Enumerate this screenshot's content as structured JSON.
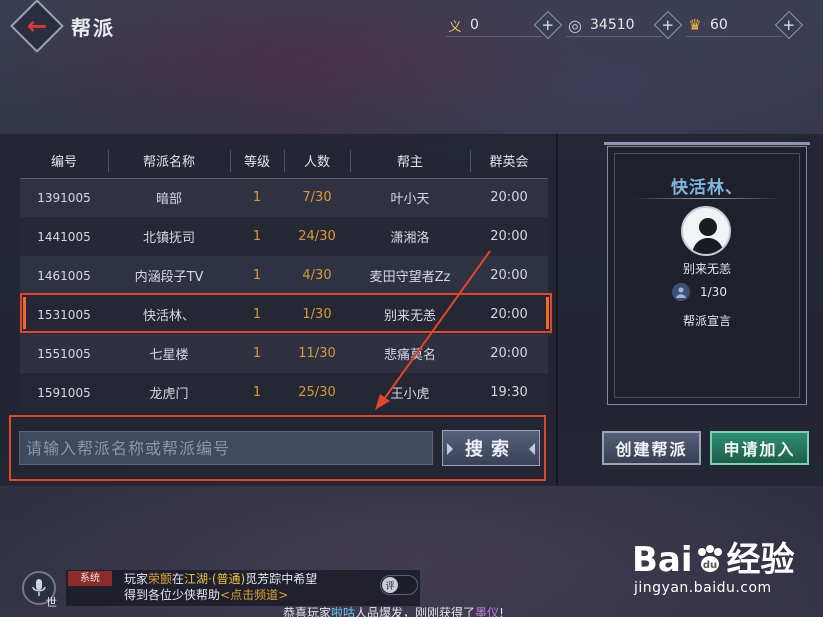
{
  "header": {
    "title": "帮派",
    "resources": [
      {
        "icon": "yi-token-icon",
        "symbol": "义",
        "value": "0"
      },
      {
        "icon": "silver-coin-icon",
        "symbol": "◎",
        "value": "34510"
      },
      {
        "icon": "gold-ingot-icon",
        "symbol": "♛",
        "value": "60"
      }
    ]
  },
  "table": {
    "headers": [
      "编号",
      "帮派名称",
      "等级",
      "人数",
      "帮主",
      "群英会"
    ],
    "rows": [
      {
        "id": "1391005",
        "name": "暗部",
        "level": "1",
        "members": "7/30",
        "leader": "叶小天",
        "time": "20:00"
      },
      {
        "id": "1441005",
        "name": "北镇抚司",
        "level": "1",
        "members": "24/30",
        "leader": "潇湘洛",
        "time": "20:00"
      },
      {
        "id": "1461005",
        "name": "内涵段子TV",
        "level": "1",
        "members": "4/30",
        "leader": "麦田守望者Zz",
        "time": "20:00"
      },
      {
        "id": "1531005",
        "name": "快活林、",
        "level": "1",
        "members": "1/30",
        "leader": "别来无恙",
        "time": "20:00"
      },
      {
        "id": "1551005",
        "name": "七星楼",
        "level": "1",
        "members": "11/30",
        "leader": "悲痛莫名",
        "time": "20:00"
      },
      {
        "id": "1591005",
        "name": "龙虎门",
        "level": "1",
        "members": "25/30",
        "leader": "王小虎",
        "time": "19:30"
      }
    ]
  },
  "search": {
    "placeholder": "请输入帮派名称或帮派编号",
    "button": "搜索"
  },
  "card": {
    "guild_name": "快活林、",
    "leader": "别来无恙",
    "members": "1/30",
    "declaration_label": "帮派宣言"
  },
  "actions": {
    "create": "创建帮派",
    "join": "申请加入"
  },
  "chat": {
    "channel_icon_label": "世",
    "tag": "系统",
    "line1_a": "玩家",
    "line1_name": "荣颤",
    "line1_b": "在",
    "line1_place": "江湖·(普通)",
    "line1_c": "觅芳踪中希望",
    "line2_a": "得到各位少侠帮助",
    "line2_link": "<点击频道>",
    "reply_label": "评"
  },
  "ticker": {
    "a": "恭喜玩家",
    "name": "啦咕",
    "b": "人品爆发，刚刚获得了",
    "item": "墨仪",
    "c": "!"
  },
  "watermark": {
    "logo_a": "Bai",
    "logo_b": "经验",
    "url": "jingyan.baidu.com"
  },
  "colors": {
    "highlight_border": "#e2452e",
    "member_count": "#d79a3a",
    "guild_name": "#7fb7e3",
    "join_button": "#2f8f73"
  }
}
